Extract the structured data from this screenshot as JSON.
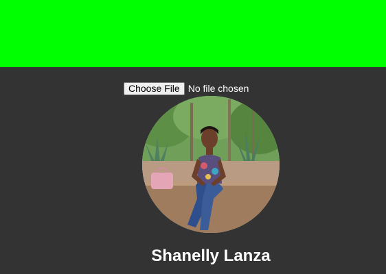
{
  "header": {
    "background_color": "#00ff00"
  },
  "page": {
    "background_color": "#333333"
  },
  "file_input": {
    "button_label": "Choose File",
    "status_text": "No file chosen"
  },
  "profile": {
    "photo": "profile-photo",
    "name": "Shanelly Lanza"
  }
}
